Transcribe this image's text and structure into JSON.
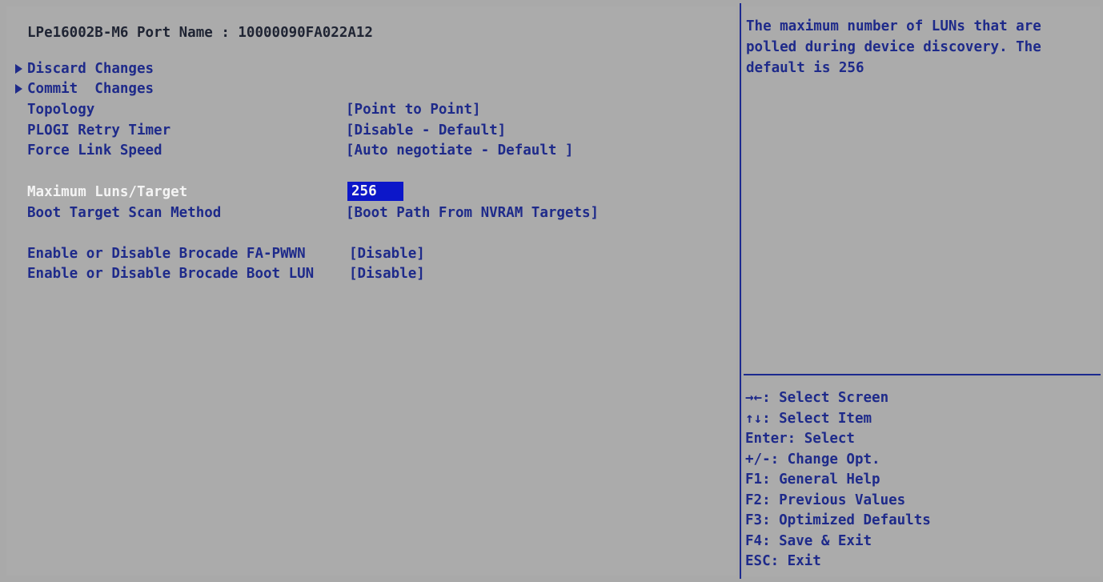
{
  "title": "LPe16002B-M6 Port Name : 10000090FA022A12",
  "menu": [
    {
      "label": "Discard Changes",
      "submenu": true
    },
    {
      "label": "Commit  Changes",
      "submenu": true
    },
    {
      "label": "Topology",
      "value": "[Point to Point]"
    },
    {
      "label": "PLOGI Retry Timer",
      "value": "[Disable - Default]"
    },
    {
      "label": "Force Link Speed",
      "value": "[Auto negotiate - Default ]"
    },
    {
      "label": "Maximum Luns/Target",
      "value": "256",
      "selected": true
    },
    {
      "label": "Boot Target Scan Method",
      "value": "[Boot Path From NVRAM Targets]"
    },
    {
      "label": "Enable or Disable Brocade FA-PWWN",
      "value": "[Disable]"
    },
    {
      "label": "Enable or Disable Brocade Boot LUN",
      "value": "[Disable]"
    }
  ],
  "help": {
    "text": "The maximum number of LUNs that are polled during device discovery. The default is 256"
  },
  "keys": [
    "→←: Select Screen",
    "↑↓: Select Item",
    "Enter: Select",
    "+/-: Change Opt.",
    "F1: General Help",
    "F2: Previous Values",
    "F3: Optimized Defaults",
    "F4: Save & Exit",
    "ESC: Exit"
  ],
  "colors": {
    "background": "#a9a9a9",
    "text": "#1e2a8a",
    "highlight": "#0c17c9",
    "divider": "#1c2a8f"
  }
}
